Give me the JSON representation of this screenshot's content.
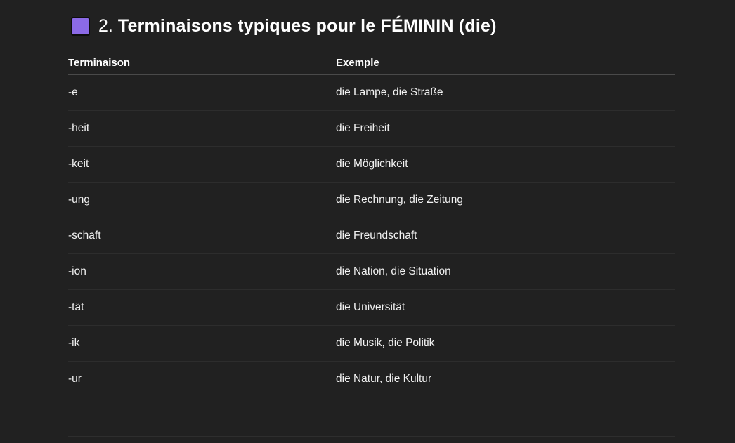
{
  "section": {
    "icon": "purple-square-icon",
    "icon_color": "#8b6ae6",
    "number": "2.",
    "title": "Terminaisons typiques pour le FÉMININ (die)"
  },
  "table": {
    "headers": [
      "Terminaison",
      "Exemple"
    ],
    "rows": [
      {
        "ending": "-e",
        "example": "die Lampe, die Straße"
      },
      {
        "ending": "-heit",
        "example": "die Freiheit"
      },
      {
        "ending": "-keit",
        "example": "die Möglichkeit"
      },
      {
        "ending": "-ung",
        "example": "die Rechnung, die Zeitung"
      },
      {
        "ending": "-schaft",
        "example": "die Freundschaft"
      },
      {
        "ending": "-ion",
        "example": "die Nation, die Situation"
      },
      {
        "ending": "-tät",
        "example": "die Universität"
      },
      {
        "ending": "-ik",
        "example": "die Musik, die Politik"
      },
      {
        "ending": "-ur",
        "example": "die Natur, die Kultur"
      }
    ]
  }
}
